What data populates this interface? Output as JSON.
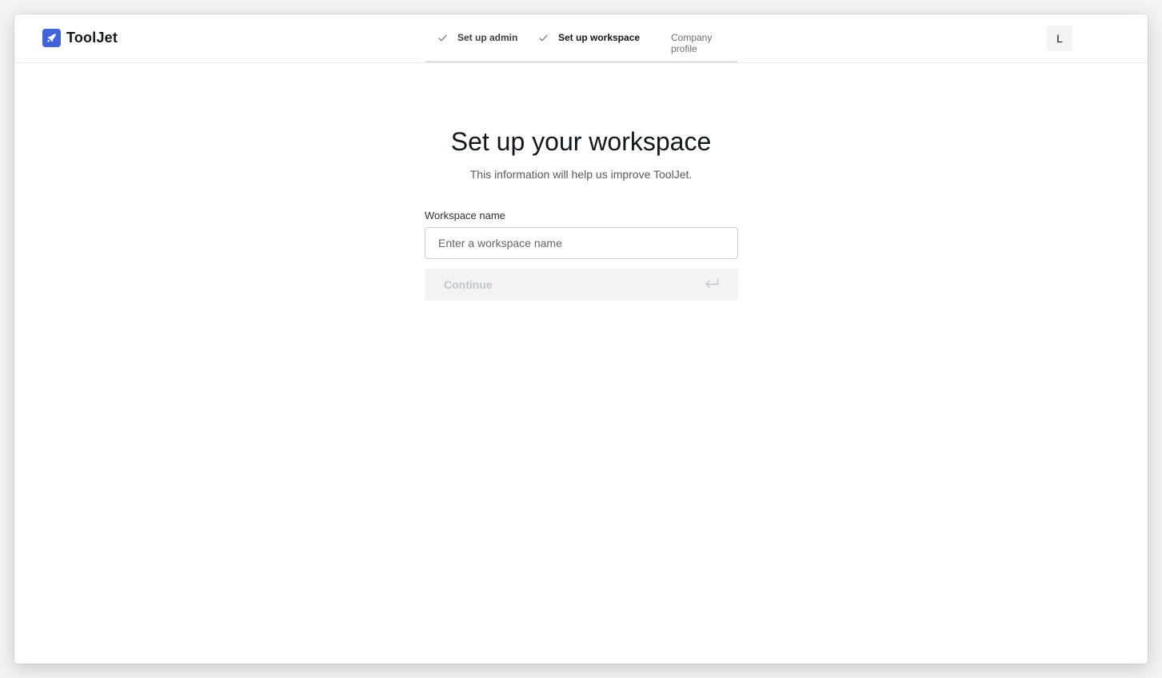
{
  "brand": {
    "name": "ToolJet",
    "logo_icon": "rocket-icon",
    "accent_color": "#3e63dd"
  },
  "steps": [
    {
      "label": "Set up admin",
      "status": "done",
      "icon": "check-icon"
    },
    {
      "label": "Set up workspace",
      "status": "active",
      "icon": "check-icon"
    },
    {
      "label": "Company profile",
      "status": "pending"
    }
  ],
  "user": {
    "avatar_initial": "L"
  },
  "main": {
    "title": "Set up your workspace",
    "subtitle": "This information will help us improve ToolJet."
  },
  "form": {
    "workspace_label": "Workspace name",
    "workspace_placeholder": "Enter a workspace name",
    "workspace_value": "",
    "continue_label": "Continue",
    "continue_icon": "enter-arrow-icon"
  }
}
